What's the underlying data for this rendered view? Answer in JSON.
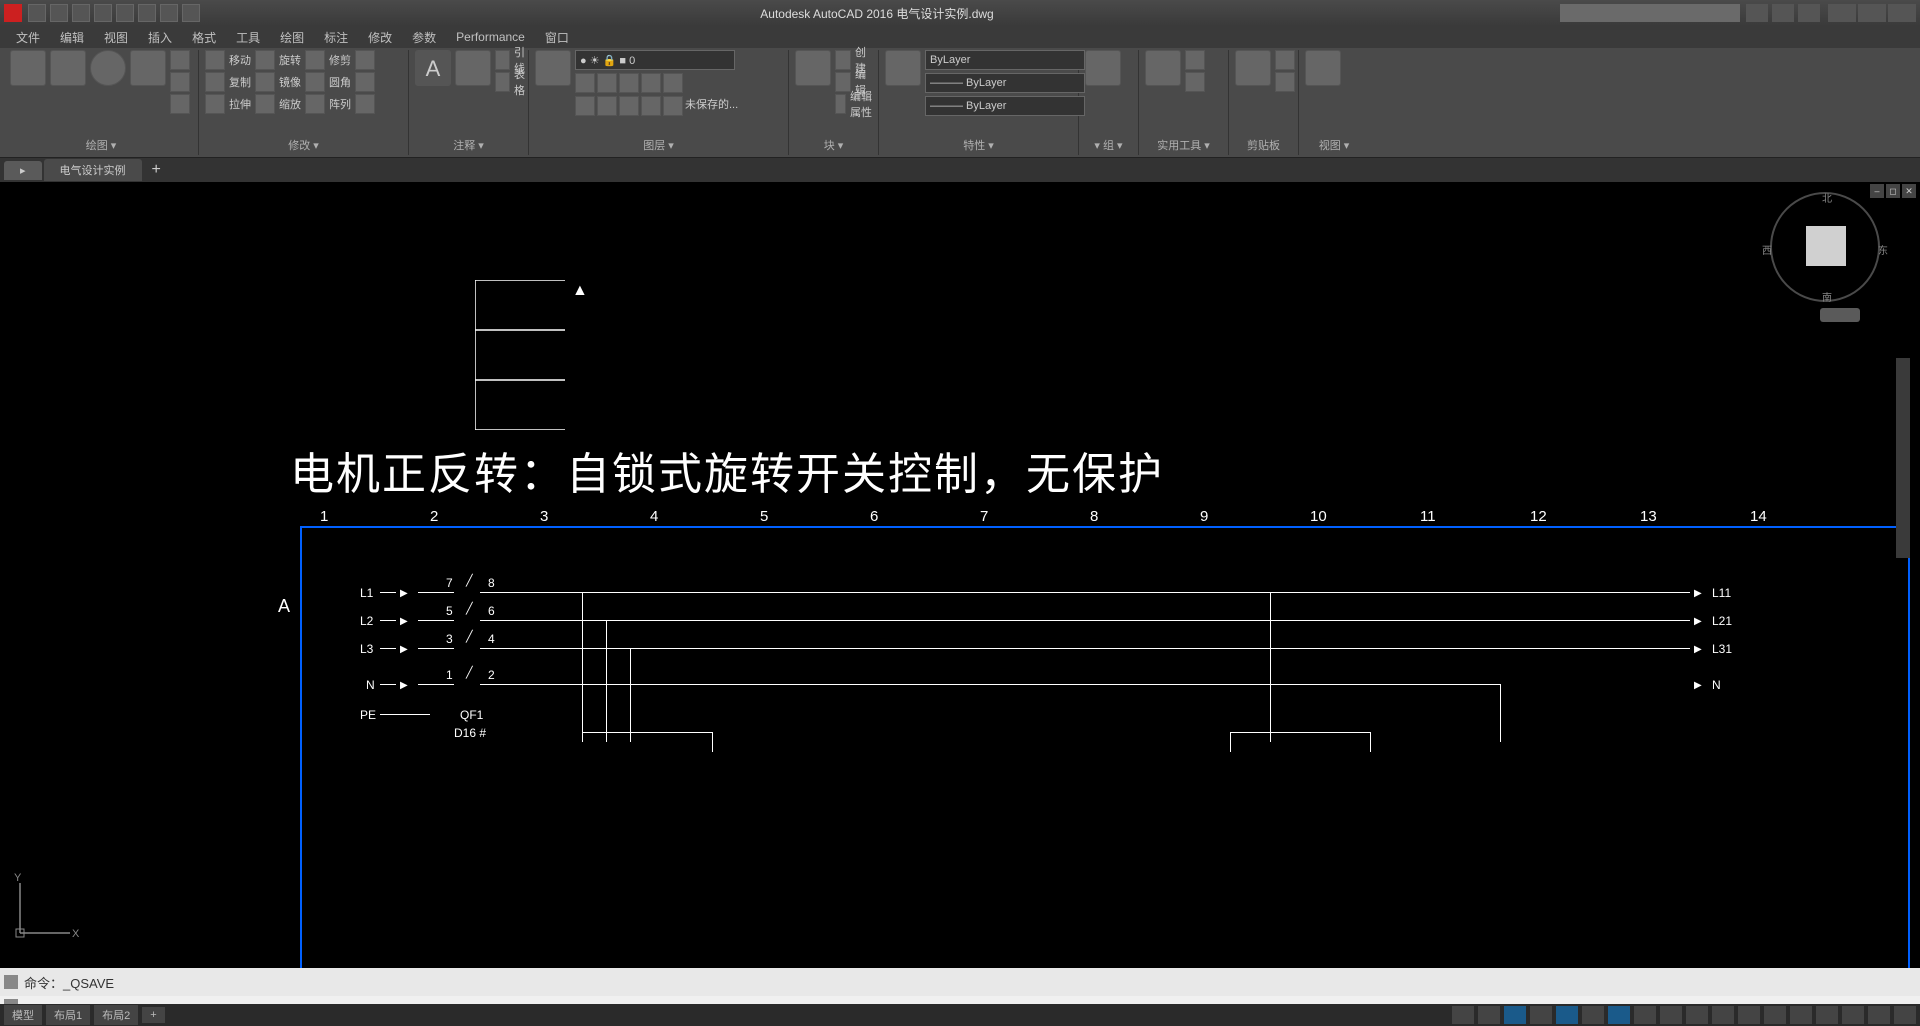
{
  "title": "Autodesk AutoCAD 2016   电气设计实例.dwg",
  "menu": [
    "文件",
    "编辑",
    "视图",
    "插入",
    "格式",
    "工具",
    "绘图",
    "标注",
    "修改",
    "参数",
    "Performance",
    "窗口"
  ],
  "ribbon": {
    "panels": [
      {
        "label": "绘图 ▾"
      },
      {
        "label": "修改 ▾"
      },
      {
        "label": "注释 ▾"
      },
      {
        "label": "图层 ▾"
      },
      {
        "label": "块 ▾"
      },
      {
        "label": "特性 ▾"
      },
      {
        "label": "▾ 组 ▾"
      },
      {
        "label": "实用工具 ▾"
      },
      {
        "label": "剪贴板"
      },
      {
        "label": "视图 ▾"
      }
    ],
    "layer_current": "ByLayer",
    "linetype": "——— ByLayer"
  },
  "doc_tabs": {
    "active": "电气设计实例"
  },
  "drawing": {
    "title_text": "电机正反转：自锁式旋转开关控制，无保护",
    "ruler": [
      "1",
      "2",
      "3",
      "4",
      "5",
      "6",
      "7",
      "8",
      "9",
      "10",
      "11",
      "12",
      "13",
      "14"
    ],
    "row": "A",
    "lines": {
      "l1": {
        "label_left": "L1",
        "seg1_l": "7",
        "seg1_r": "8",
        "label_right": "L11"
      },
      "l2": {
        "label_left": "L2",
        "seg1_l": "5",
        "seg1_r": "6",
        "label_right": "L21"
      },
      "l3": {
        "label_left": "L3",
        "seg1_l": "3",
        "seg1_r": "4",
        "label_right": "L31"
      },
      "n": {
        "label_left": "N",
        "seg1_l": "1",
        "seg1_r": "2",
        "label_right": "N"
      }
    },
    "pe": "PE",
    "qf": "QF1",
    "d16": "D16  #"
  },
  "command": {
    "history": "命令：_QSAVE"
  },
  "status": {
    "model": "模型",
    "layout1": "布局1",
    "layout2": "布局2"
  }
}
